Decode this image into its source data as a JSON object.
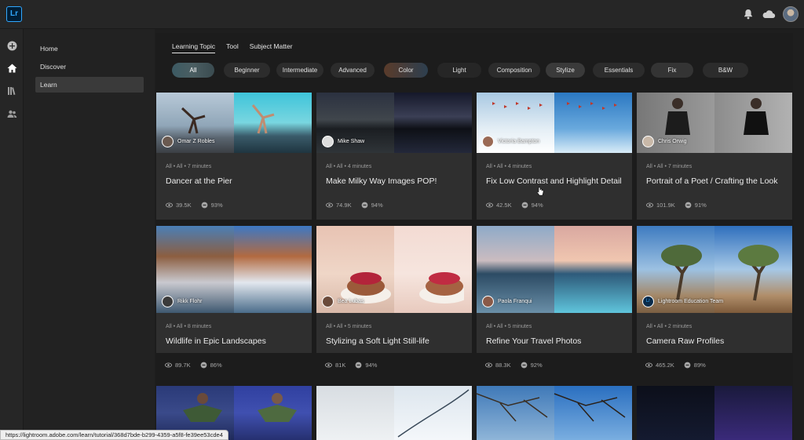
{
  "app": {
    "logo_text": "Lr"
  },
  "topbar": {
    "icons": [
      "bell-icon",
      "cloud-icon",
      "user-avatar"
    ]
  },
  "rail": {
    "icons": [
      "add-icon",
      "home-icon",
      "library-icon",
      "people-icon"
    ]
  },
  "nav": {
    "items": [
      {
        "label": "Home"
      },
      {
        "label": "Discover"
      },
      {
        "label": "Learn",
        "active": true
      }
    ]
  },
  "tabs": [
    {
      "label": "Learning Topic",
      "active": true
    },
    {
      "label": "Tool"
    },
    {
      "label": "Subject Matter"
    }
  ],
  "filters": [
    {
      "label": "All",
      "active": true
    },
    {
      "label": "Beginner"
    },
    {
      "label": "Intermediate"
    },
    {
      "label": "Advanced"
    },
    {
      "label": "Color"
    },
    {
      "label": "Light"
    },
    {
      "label": "Composition"
    },
    {
      "label": "Stylize"
    },
    {
      "label": "Essentials"
    },
    {
      "label": "Fix"
    },
    {
      "label": "B&W"
    }
  ],
  "cards": [
    {
      "author": "Omar Z Robles",
      "meta": "All • All • 7 minutes",
      "title": "Dancer at the Pier",
      "views": "39.5K",
      "rating": "93%"
    },
    {
      "author": "Mike Shaw",
      "meta": "All • All • 4 minutes",
      "title": "Make Milky Way Images POP!",
      "views": "74.9K",
      "rating": "94%"
    },
    {
      "author": "Victoria Bampton",
      "meta": "All • All • 4 minutes",
      "title": "Fix Low Contrast and Highlight Detail",
      "views": "42.5K",
      "rating": "94%"
    },
    {
      "author": "Chris Orwig",
      "meta": "All • All • 7 minutes",
      "title": "Portrait of a Poet / Crafting the Look",
      "views": "101.9K",
      "rating": "91%"
    },
    {
      "author": "Rikk Flohr",
      "meta": "All • All • 8 minutes",
      "title": "Wildlife in Epic Landscapes",
      "views": "89.7K",
      "rating": "86%"
    },
    {
      "author": "Bea Lubas",
      "meta": "All • All • 5 minutes",
      "title": "Stylizing a Soft Light Still-life",
      "views": "81K",
      "rating": "94%"
    },
    {
      "author": "Paola Franqui",
      "meta": "All • All • 5 minutes",
      "title": "Refine Your Travel Photos",
      "views": "88.3K",
      "rating": "92%"
    },
    {
      "author": "Lightroom Education Team",
      "meta": "All • All • 2 minutes",
      "title": "Camera Raw Profiles",
      "views": "465.2K",
      "rating": "89%"
    },
    {
      "author": "",
      "meta": "",
      "title": "",
      "views": "",
      "rating": ""
    },
    {
      "author": "",
      "meta": "",
      "title": "",
      "views": "",
      "rating": ""
    },
    {
      "author": "",
      "meta": "",
      "title": "",
      "views": "",
      "rating": ""
    },
    {
      "author": "",
      "meta": "",
      "title": "",
      "views": "",
      "rating": ""
    }
  ],
  "status_url": "https://lightroom.adobe.com/learn/tutorial/368d7bde-b299-4359-a5f8-fe39ee53cde4",
  "colors": {
    "accent": "#31a8ff",
    "background": "#1e1e1e",
    "card": "#2f2f2f"
  }
}
